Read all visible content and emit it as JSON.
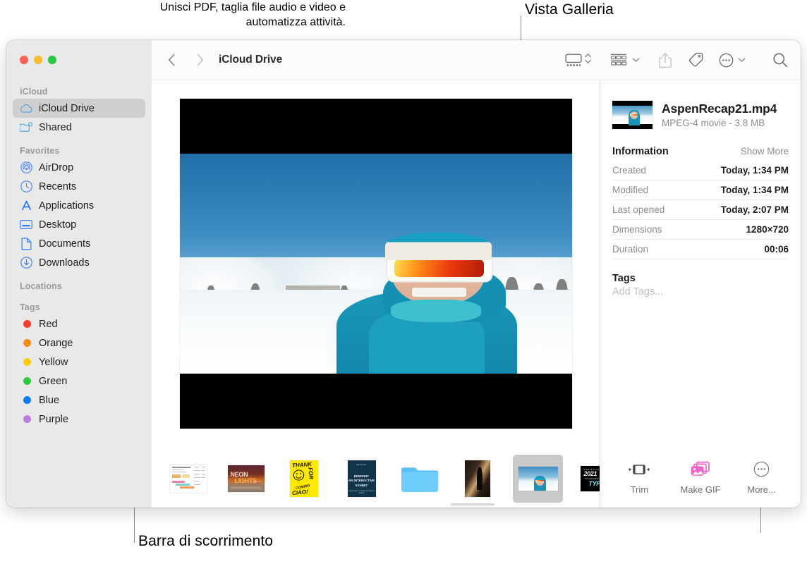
{
  "annotations": {
    "gallery_view": "Vista Galleria",
    "scrollbar": "Barra di scorrimento",
    "quick_actions_line1": "Unisci PDF, taglia file audio e video e",
    "quick_actions_line2": "automatizza attività."
  },
  "window": {
    "traffic_lights": {
      "close": "close-button",
      "minimize": "minimize-button",
      "zoom": "zoom-button"
    }
  },
  "sidebar": {
    "sections": [
      {
        "header": "iCloud",
        "items": [
          {
            "label": "iCloud Drive",
            "icon": "cloud-icon",
            "selected": true
          },
          {
            "label": "Shared",
            "icon": "shared-folder-icon",
            "selected": false
          }
        ]
      },
      {
        "header": "Favorites",
        "items": [
          {
            "label": "AirDrop",
            "icon": "airdrop-icon",
            "selected": false
          },
          {
            "label": "Recents",
            "icon": "clock-icon",
            "selected": false
          },
          {
            "label": "Applications",
            "icon": "applications-icon",
            "selected": false
          },
          {
            "label": "Desktop",
            "icon": "desktop-icon",
            "selected": false
          },
          {
            "label": "Documents",
            "icon": "document-icon",
            "selected": false
          },
          {
            "label": "Downloads",
            "icon": "download-icon",
            "selected": false
          }
        ]
      },
      {
        "header": "Locations",
        "items": []
      },
      {
        "header": "Tags",
        "items": [
          {
            "label": "Red",
            "icon": "tag-dot-icon",
            "color": "#fc3b2d"
          },
          {
            "label": "Orange",
            "icon": "tag-dot-icon",
            "color": "#f98c0a"
          },
          {
            "label": "Yellow",
            "icon": "tag-dot-icon",
            "color": "#ffcc02"
          },
          {
            "label": "Green",
            "icon": "tag-dot-icon",
            "color": "#2ecb41"
          },
          {
            "label": "Blue",
            "icon": "tag-dot-icon",
            "color": "#0a7cf7"
          },
          {
            "label": "Purple",
            "icon": "tag-dot-icon",
            "color": "#ba7de0"
          }
        ]
      }
    ]
  },
  "toolbar": {
    "back": "back-button",
    "forward": "forward-button",
    "path_title": "iCloud Drive",
    "view_mode": "gallery-view-button",
    "group_by": "group-by-button",
    "share": "share-button",
    "tag": "tag-button",
    "more": "more-actions-button",
    "search": "search-button"
  },
  "file_info": {
    "name": "AspenRecap21.mp4",
    "meta": "MPEG-4 movie - 3.8 MB",
    "information_title": "Information",
    "show_more": "Show More",
    "rows": [
      {
        "key": "Created",
        "value": "Today, 1:34 PM"
      },
      {
        "key": "Modified",
        "value": "Today, 1:34 PM"
      },
      {
        "key": "Last opened",
        "value": "Today, 2:07 PM"
      },
      {
        "key": "Dimensions",
        "value": "1280×720"
      },
      {
        "key": "Duration",
        "value": "00:06"
      }
    ],
    "tags_title": "Tags",
    "tags_placeholder": "Add Tags..."
  },
  "quick_actions": [
    {
      "label": "Trim",
      "icon": "trim-icon"
    },
    {
      "label": "Make GIF",
      "icon": "make-gif-icon"
    },
    {
      "label": "More...",
      "icon": "more-circle-icon"
    }
  ],
  "filmstrip": {
    "items": [
      {
        "name": "chart-document-thumbnail",
        "selected": false
      },
      {
        "name": "neon-lights-poster-thumbnail",
        "selected": false
      },
      {
        "name": "thank-you-yellow-poster-thumbnail",
        "selected": false
      },
      {
        "name": "remixed-exhibit-poster-thumbnail",
        "selected": false
      },
      {
        "name": "folder-thumbnail",
        "selected": false
      },
      {
        "name": "dark-corridor-photo-thumbnail",
        "selected": false
      },
      {
        "name": "aspen-recap-video-thumbnail",
        "selected": true
      },
      {
        "name": "portfolio-2021-poster-thumbnail",
        "selected": false
      },
      {
        "name": "gold-balloons-photo-thumbnail",
        "selected": false
      }
    ],
    "scrollbar": "horizontal-scrollbar"
  },
  "preview": {
    "name": "video-preview-still",
    "alt": "Skier in teal jacket with orange goggles on snowy mountain"
  },
  "colors": {
    "sidebar_bg": "#e9e9e9",
    "selection": "#cfcfcf",
    "accent_blue": "#0a7cf7",
    "gif_pink": "#ee62c4"
  }
}
